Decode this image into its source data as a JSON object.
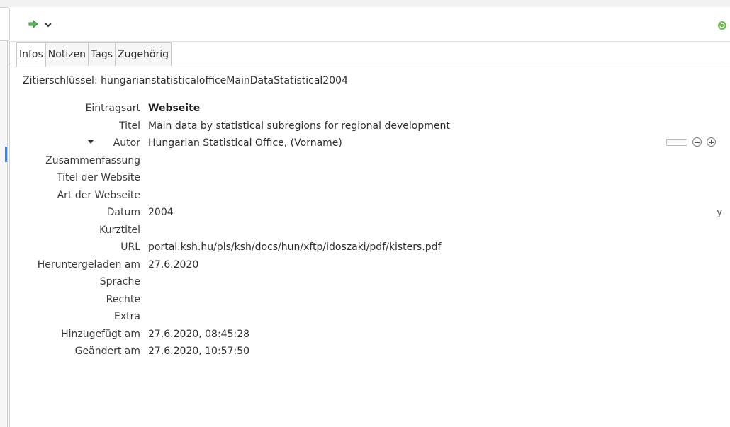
{
  "toolbar": {
    "locate_icon": "green-arrow-right-icon",
    "dropdown_icon": "chevron-down-icon",
    "sync_icon": "green-refresh-icon"
  },
  "tabs": [
    {
      "label": "Infos",
      "active": true
    },
    {
      "label": "Notizen",
      "active": false
    },
    {
      "label": "Tags",
      "active": false
    },
    {
      "label": "Zugehörig",
      "active": false
    }
  ],
  "citekey": "Zitierschlüssel: hungarianstatisticalofficeMainDataStatistical2004",
  "fields": [
    {
      "label": "Eintragsart",
      "value": "Webseite"
    },
    {
      "label": "Titel",
      "value": "Main data by statistical subregions for regional development"
    },
    {
      "label": "Autor",
      "value": "Hungarian Statistical Office, (Vorname)"
    },
    {
      "label": "Zusammenfassung",
      "value": ""
    },
    {
      "label": "Titel der Website",
      "value": ""
    },
    {
      "label": "Art der Webseite",
      "value": ""
    },
    {
      "label": "Datum",
      "value": "2004",
      "suffix": "y"
    },
    {
      "label": "Kurztitel",
      "value": ""
    },
    {
      "label": "URL",
      "value": "portal.ksh.hu/pls/ksh/docs/hun/xftp/idoszaki/pdf/kisters.pdf"
    },
    {
      "label": "Heruntergeladen am",
      "value": "27.6.2020"
    },
    {
      "label": "Sprache",
      "value": ""
    },
    {
      "label": "Rechte",
      "value": ""
    },
    {
      "label": "Extra",
      "value": ""
    },
    {
      "label": "Hinzugefügt am",
      "value": "27.6.2020, 08:45:28"
    },
    {
      "label": "Geändert am",
      "value": "27.6.2020, 10:57:50"
    }
  ],
  "colors": {
    "accent": "#3584e4",
    "green": "#4caf50"
  }
}
